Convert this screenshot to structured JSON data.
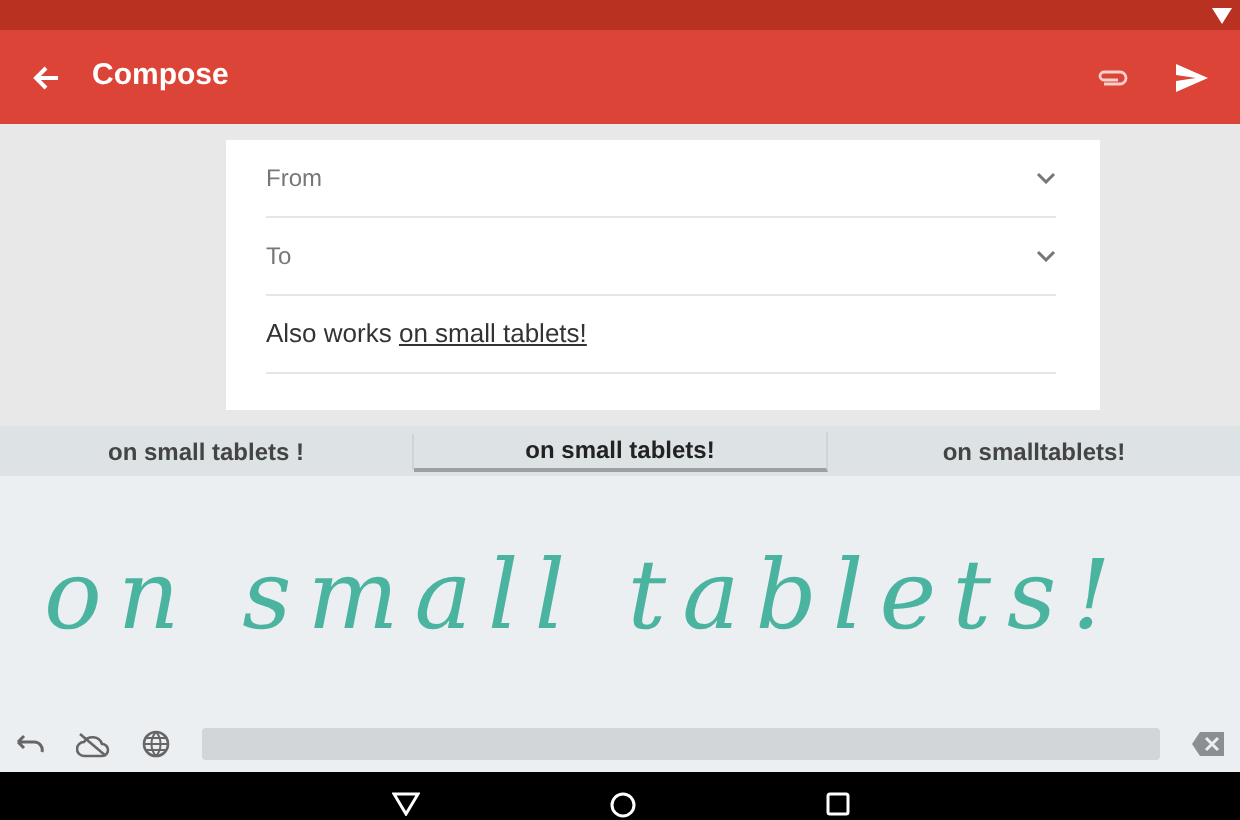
{
  "app_bar": {
    "title": "Compose"
  },
  "fields": [
    {
      "label": "From",
      "expanded": false
    },
    {
      "label": "To",
      "expanded": false
    }
  ],
  "body": {
    "text": "Also works ",
    "composing_text": "on small tablets!"
  },
  "suggestions": [
    {
      "text": "on small tablets !",
      "selected": false
    },
    {
      "text": "on small tablets!",
      "selected": true
    },
    {
      "text": "on smalltablets!",
      "selected": false
    }
  ],
  "handwriting": {
    "ink": "on small tablets!"
  }
}
